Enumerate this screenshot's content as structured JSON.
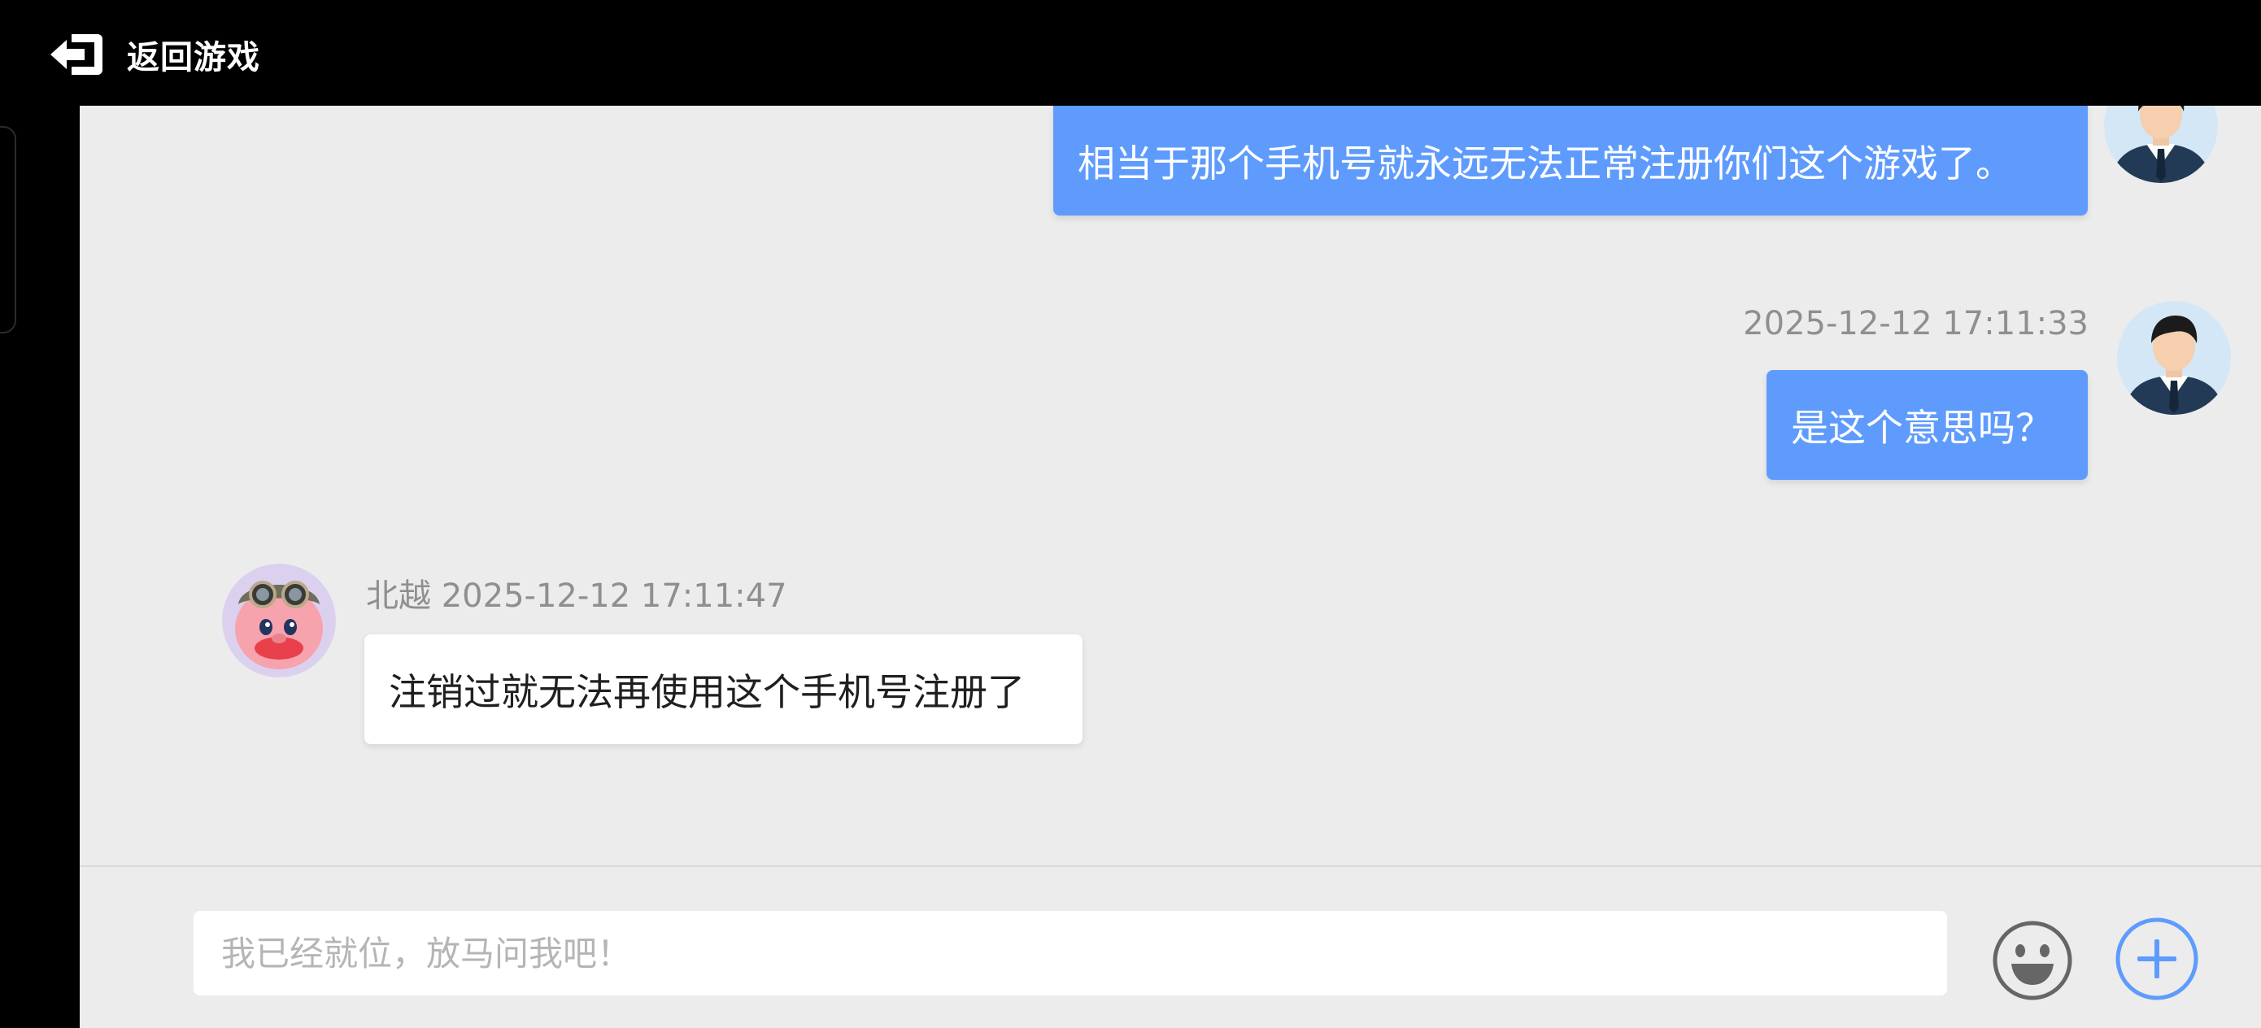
{
  "header": {
    "back_label": "返回游戏"
  },
  "messages": [
    {
      "direction": "outgoing",
      "timestamp": "",
      "text": "相当于那个手机号就永远无法正常注册你们这个游戏了。"
    },
    {
      "direction": "outgoing",
      "timestamp": "2025-12-12 17:11:33",
      "text": "是这个意思吗？"
    },
    {
      "direction": "incoming",
      "sender": "北越",
      "timestamp": "2025-12-12 17:11:47",
      "text": "注销过就无法再使用这个手机号注册了"
    }
  ],
  "composer": {
    "placeholder": "我已经就位，放马问我吧！",
    "value": ""
  },
  "colors": {
    "outgoing_bubble": "#5e9bfd",
    "incoming_bubble": "#ffffff",
    "chat_background": "#ececec",
    "header_background": "#000000",
    "accent": "#5e9bfd"
  },
  "icons": {
    "back": "exit-arrow-icon",
    "emoji": "smiley-face-icon",
    "more": "plus-circle-icon",
    "user_avatar": "businessman-avatar",
    "agent_avatar": "pink-pig-pilot-avatar"
  }
}
